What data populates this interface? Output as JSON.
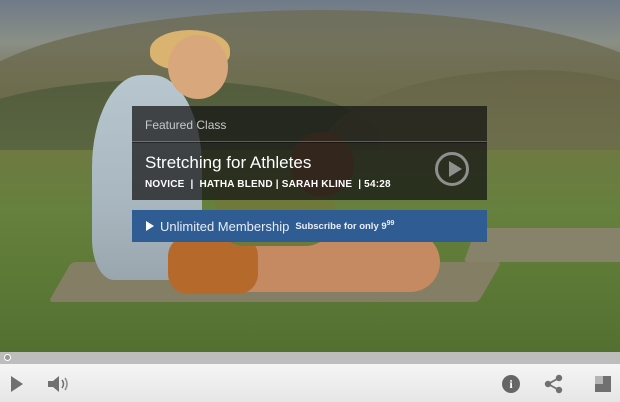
{
  "overlay": {
    "header": "Featured Class",
    "title": "Stretching for Athletes",
    "meta": "NOVICE  |  HATHA BLEND | SARAH KLINE  | 54:28",
    "membership_label": "Unlimited Membership",
    "membership_sub": "Subscribe for only 9",
    "membership_sup": "99"
  },
  "controls": {
    "progress_fraction": 0
  },
  "icons": {
    "play": "play-icon",
    "volume": "volume-icon",
    "info": "info-icon",
    "share": "share-icon",
    "fullscreen": "fullscreen-icon"
  },
  "colors": {
    "membership_bg": "#2e5c93",
    "overlay_bg": "#121212"
  }
}
